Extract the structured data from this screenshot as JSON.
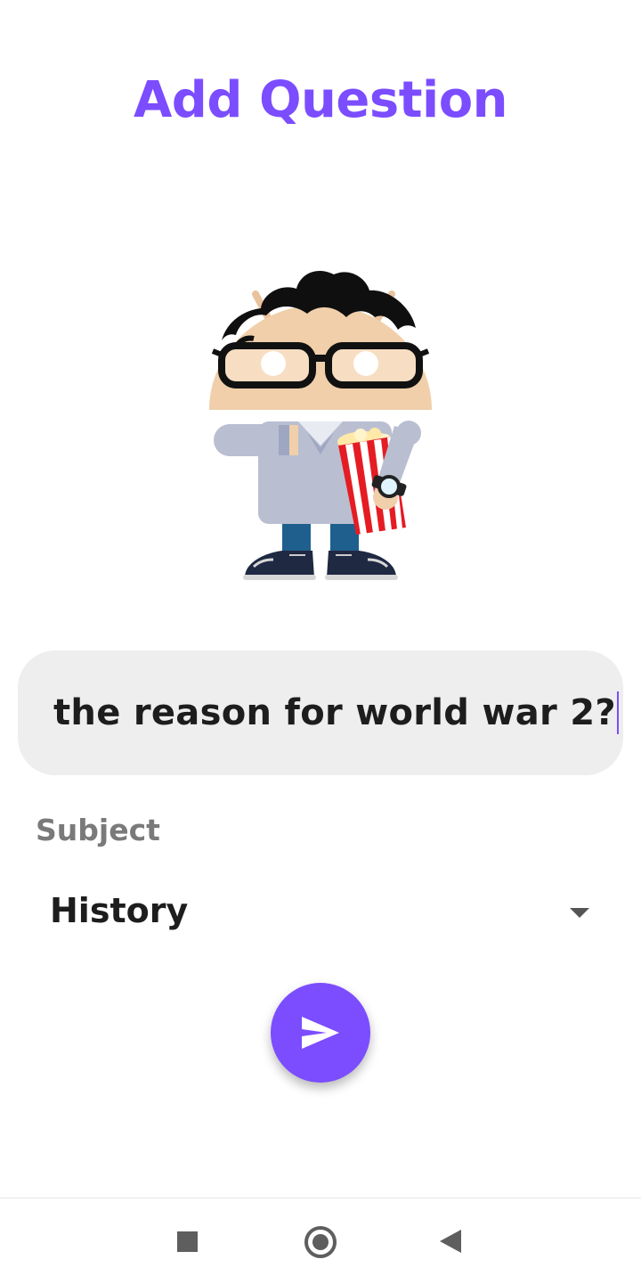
{
  "header": {
    "title": "Add Question"
  },
  "question": {
    "value": "the reason for world war 2?"
  },
  "subject": {
    "label": "Subject",
    "selected": "History"
  },
  "colors": {
    "accent": "#7b4dff",
    "input_background": "#eeeeee",
    "text_dark": "#1d1d1d",
    "label_gray": "#7a7a7a",
    "nav_icon": "#5e5e5e"
  },
  "icons": {
    "mascot": "android-nerd-popcorn-illustration",
    "send": "send-icon",
    "dropdown": "chevron-down-icon",
    "nav_recents": "square-icon",
    "nav_home": "circle-icon",
    "nav_back": "triangle-back-icon"
  }
}
